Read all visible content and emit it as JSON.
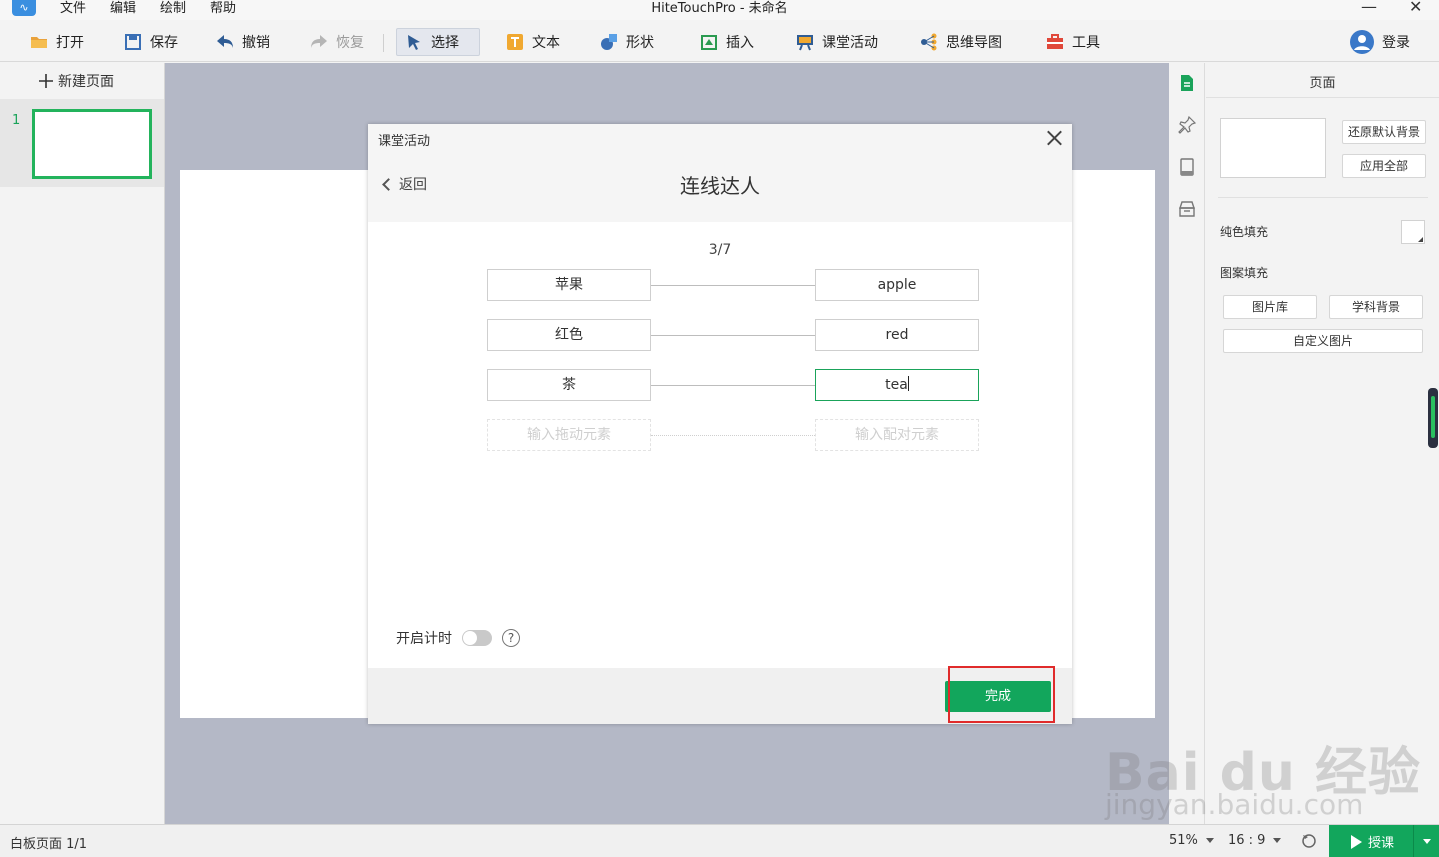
{
  "app": {
    "title": "HiteTouchPro - 未命名",
    "menu": [
      "文件",
      "编辑",
      "绘制",
      "帮助"
    ],
    "close_glyph": "✕",
    "minimize_glyph": "—"
  },
  "toolbar": {
    "items": [
      {
        "label": "打开",
        "icon": "folder-icon"
      },
      {
        "label": "保存",
        "icon": "save-icon"
      },
      {
        "label": "撤销",
        "icon": "undo-icon"
      },
      {
        "label": "恢复",
        "icon": "redo-icon"
      },
      {
        "label": "选择",
        "icon": "cursor-icon"
      },
      {
        "label": "文本",
        "icon": "text-icon"
      },
      {
        "label": "形状",
        "icon": "shape-icon"
      },
      {
        "label": "插入",
        "icon": "insert-icon"
      },
      {
        "label": "课堂活动",
        "icon": "classroom-icon"
      },
      {
        "label": "思维导图",
        "icon": "mindmap-icon"
      },
      {
        "label": "工具",
        "icon": "toolbox-icon"
      }
    ],
    "login_label": "登录"
  },
  "left_panel": {
    "new_page_label": "新建页面",
    "pages": [
      {
        "number": "1"
      }
    ]
  },
  "dialog": {
    "title": "课堂活动",
    "back_label": "返回",
    "activity_name": "连线达人",
    "progress": "3/7",
    "pairs": [
      {
        "left": "苹果",
        "right": "apple"
      },
      {
        "left": "红色",
        "right": "red"
      },
      {
        "left": "茶",
        "right": "tea"
      }
    ],
    "placeholder_left": "输入拖动元素",
    "placeholder_right": "输入配对元素",
    "timer_label": "开启计时",
    "help_glyph": "?",
    "done_label": "完成"
  },
  "right_panel": {
    "title": "页面",
    "restore_bg_label": "还原默认背景",
    "apply_all_label": "应用全部",
    "solid_fill_label": "纯色填充",
    "pattern_fill_label": "图案填充",
    "gallery_label": "图片库",
    "subject_bg_label": "学科背景",
    "custom_image_label": "自定义图片"
  },
  "statusbar": {
    "page_info": "白板页面 1/1",
    "zoom": "51%",
    "ratio": "16 : 9",
    "teach_label": "授课"
  },
  "watermark": {
    "brand": "Bai du 经验",
    "url": "jingyan.baidu.com"
  },
  "colors": {
    "accent_green": "#12a65c",
    "highlight_red": "#e02b2b",
    "canvas_bg": "#b4b8c6"
  }
}
